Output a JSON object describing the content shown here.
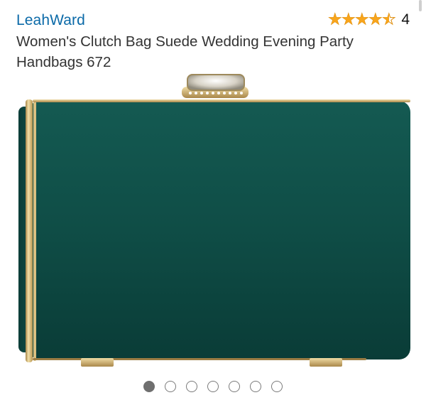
{
  "product": {
    "brand": "LeahWard",
    "title": "Women's Clutch Bag Suede Wedding Evening Party Handbags 672",
    "rating": {
      "stars": 4.5,
      "max": 5,
      "count": "4"
    },
    "image": {
      "bag_color": "#0d4a43",
      "frame_color": "#c9a765"
    }
  },
  "carousel": {
    "total": 7,
    "active_index": 0
  },
  "colors": {
    "link": "#0b6aa8",
    "star": "#f8a51c"
  }
}
